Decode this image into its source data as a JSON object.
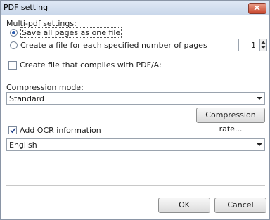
{
  "window": {
    "title": "PDF setting"
  },
  "multi_pdf": {
    "heading": "Multi-pdf settings:",
    "option_single": "Save all pages as one file",
    "option_split": "Create a file for each specified number of pages",
    "pages_value": "1"
  },
  "pdfa": {
    "label": "Create file that complies with PDF/A:"
  },
  "compression": {
    "label": "Compression mode:",
    "selected": "Standard",
    "rate_button": "Compression rate..."
  },
  "ocr": {
    "label": "Add OCR information",
    "language_selected": "English"
  },
  "buttons": {
    "ok": "OK",
    "cancel": "Cancel"
  }
}
